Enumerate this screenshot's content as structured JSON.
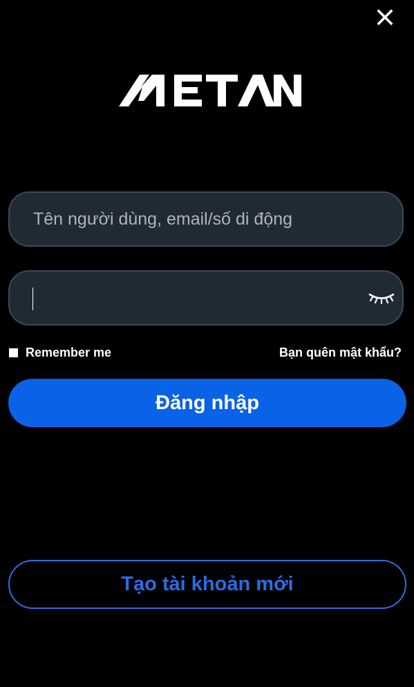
{
  "header": {
    "close_icon": "close-icon"
  },
  "logo": {
    "text": "METAN"
  },
  "form": {
    "username_placeholder": "Tên người dùng, email/số di động",
    "username_value": "",
    "password_value": "",
    "password_toggle_icon": "eye-closed-icon",
    "remember_label": "Remember me",
    "remember_checked": false,
    "forgot_label": "Bạn quên mật khẩu?",
    "login_label": "Đăng nhập"
  },
  "footer": {
    "create_account_label": "Tạo tài khoản mới"
  },
  "colors": {
    "background": "#000000",
    "field_bg": "#1f2a35",
    "field_border": "#3a4a57",
    "primary": "#0a63e6",
    "outline_accent": "#2f6fe0",
    "placeholder": "#aeb5bb",
    "text": "#ffffff"
  }
}
